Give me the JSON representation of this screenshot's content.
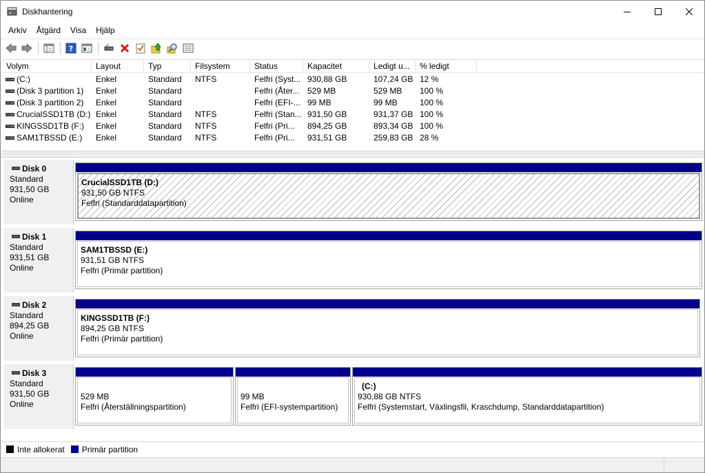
{
  "window": {
    "title": "Diskhantering",
    "icon": "disk-management-icon"
  },
  "menu": [
    "Arkiv",
    "Åtgärd",
    "Visa",
    "Hjälp"
  ],
  "toolbar": {
    "icons": [
      "back-arrow-icon",
      "forward-arrow-icon",
      "console-tree-icon",
      "help-icon",
      "properties-view-icon",
      "connect-drive-icon",
      "delete-red-x-icon",
      "checklist-icon",
      "folder-up-icon",
      "search-icon",
      "list-icon"
    ]
  },
  "volume_list": {
    "columns": [
      "Volym",
      "Layout",
      "Typ",
      "Filsystem",
      "Status",
      "Kapacitet",
      "Ledigt u...",
      "% ledigt"
    ],
    "rows": [
      [
        "(C:)",
        "Enkel",
        "Standard",
        "NTFS",
        "Felfri (Syst...",
        "930,88 GB",
        "107,24 GB",
        "12 %"
      ],
      [
        "(Disk 3 partition 1)",
        "Enkel",
        "Standard",
        "",
        "Felfri (Åter...",
        "529 MB",
        "529 MB",
        "100 %"
      ],
      [
        "(Disk 3 partition 2)",
        "Enkel",
        "Standard",
        "",
        "Felfri (EFI-...",
        "99 MB",
        "99 MB",
        "100 %"
      ],
      [
        "CrucialSSD1TB (D:)",
        "Enkel",
        "Standard",
        "NTFS",
        "Felfri (Stan...",
        "931,50 GB",
        "931,37 GB",
        "100 %"
      ],
      [
        "KINGSSD1TB (F:)",
        "Enkel",
        "Standard",
        "NTFS",
        "Felfri (Pri...",
        "894,25 GB",
        "893,34 GB",
        "100 %"
      ],
      [
        "SAM1TBSSD (E:)",
        "Enkel",
        "Standard",
        "NTFS",
        "Felfri (Pri...",
        "931,51 GB",
        "259,83 GB",
        "28 %"
      ]
    ]
  },
  "disks": [
    {
      "name": "Disk 0",
      "type": "Standard",
      "size": "931,50 GB",
      "state": "Online",
      "partitions": [
        {
          "name": "CrucialSSD1TB  (D:)",
          "size": "931,50 GB NTFS",
          "status": "Felfri (Standarddatapartition)",
          "selected": true
        }
      ]
    },
    {
      "name": "Disk 1",
      "type": "Standard",
      "size": "931,51 GB",
      "state": "Online",
      "partitions": [
        {
          "name": "SAM1TBSSD  (E:)",
          "size": "931,51 GB NTFS",
          "status": "Felfri (Primär partition)"
        }
      ]
    },
    {
      "name": "Disk 2",
      "type": "Standard",
      "size": "894,25 GB",
      "state": "Online",
      "partitions": [
        {
          "name": "KINGSSD1TB  (F:)",
          "size": "894,25 GB NTFS",
          "status": "Felfri (Primär partition)"
        }
      ]
    },
    {
      "name": "Disk 3",
      "type": "Standard",
      "size": "931,50 GB",
      "state": "Online",
      "partitions": [
        {
          "name": "",
          "size": "529 MB",
          "status": "Felfri (Återställningspartition)"
        },
        {
          "name": "",
          "size": "99 MB",
          "status": "Felfri (EFI-systempartition)"
        },
        {
          "name": "(C:)",
          "size": "930,88 GB NTFS",
          "status": "Felfri (Systemstart, Växlingsfil, Kraschdump, Standarddatapartition)"
        }
      ]
    }
  ],
  "legend": [
    {
      "label": "Inte allokerat",
      "color": "#000000"
    },
    {
      "label": "Primär partition",
      "color": "#00008b"
    }
  ]
}
